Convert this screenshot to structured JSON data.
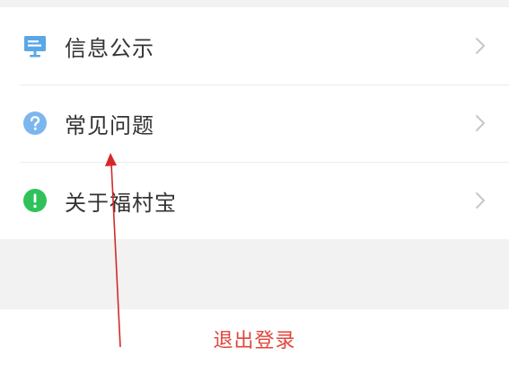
{
  "menu": {
    "items": [
      {
        "label": "信息公示",
        "icon": "notice-board-icon",
        "icon_color": "#5aa7e8"
      },
      {
        "label": "常见问题",
        "icon": "question-icon",
        "icon_color": "#7cb6ee"
      },
      {
        "label": "关于福村宝",
        "icon": "info-exclamation-icon",
        "icon_color": "#2fc25b"
      }
    ],
    "chevron_icon": "chevron-right-icon"
  },
  "logout": {
    "label": "退出登录",
    "color": "#e2453b"
  },
  "annotation": {
    "arrow_color": "#d42a2a"
  }
}
